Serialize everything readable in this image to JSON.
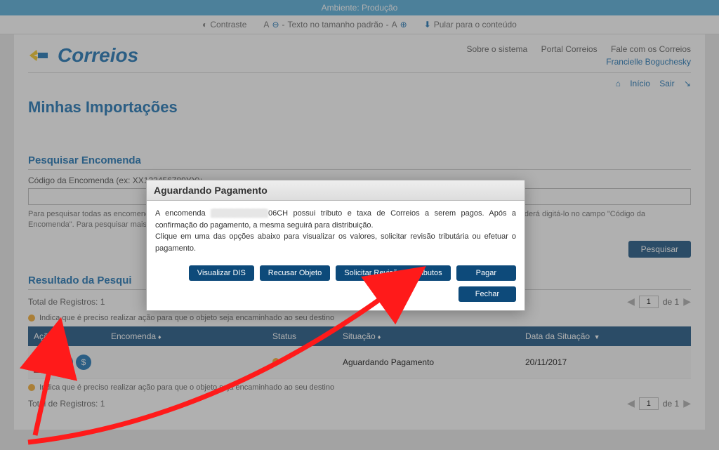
{
  "env": "Ambiente: Produção",
  "util": {
    "contrast": "Contraste",
    "textsize_prefix": "A",
    "textsize": "Texto no tamanho padrão",
    "textsize_suffix": "A",
    "skip": "Pular para o conteúdo"
  },
  "brand": "Correios",
  "top_links": {
    "about": "Sobre o sistema",
    "portal": "Portal Correios",
    "contact": "Fale com os Correios"
  },
  "user": "Francielle Boguchesky",
  "crumb": {
    "home": "Início",
    "exit": "Sair"
  },
  "page_title": "Minhas Importações",
  "search": {
    "section": "Pesquisar Encomenda",
    "label": "Código da Encomenda (ex: XX123456789YY):",
    "help": "Para pesquisar todas as encomendas basta deixar o campo em branco e clicar em pesquisar. Caso a pesquisa não retorne o objeto desejado poderá digitá-lo no campo \"Código da Encomenda\". Para pesquisar mais de um objeto separe-os por ; (ponto e vírgula)",
    "button": "Pesquisar"
  },
  "results": {
    "section": "Resultado da Pesqui",
    "total_label": "Total de Registros:",
    "total_value": "1",
    "page_of": "de 1",
    "page_current": "1",
    "notice": "Indica que é preciso realizar ação para que o objeto seja encaminhado ao seu destino",
    "cols": {
      "acao": "Ação",
      "encomenda": "Encomenda",
      "status": "Status",
      "situacao": "Situação",
      "data": "Data da Situação"
    },
    "row": {
      "situacao": "Aguardando Pagamento",
      "data": "20/11/2017"
    }
  },
  "modal": {
    "title": "Aguardando Pagamento",
    "body_p1a": "A encomenda ",
    "body_mask": "██████████",
    "body_suffix": "06CH",
    "body_p1b": " possui tributo e taxa de Correios a serem pagos. Após a confirmação do pagamento, a mesma seguirá para distribuição.",
    "body_p2": "Clique em uma das opções abaixo para visualizar os valores, solicitar revisão tributária ou efetuar o pagamento.",
    "btn_dis": "Visualizar DIS",
    "btn_recusar": "Recusar Objeto",
    "btn_revisao": "Solicitar Revisão de Tributos",
    "btn_pagar": "Pagar",
    "btn_fechar": "Fechar"
  }
}
